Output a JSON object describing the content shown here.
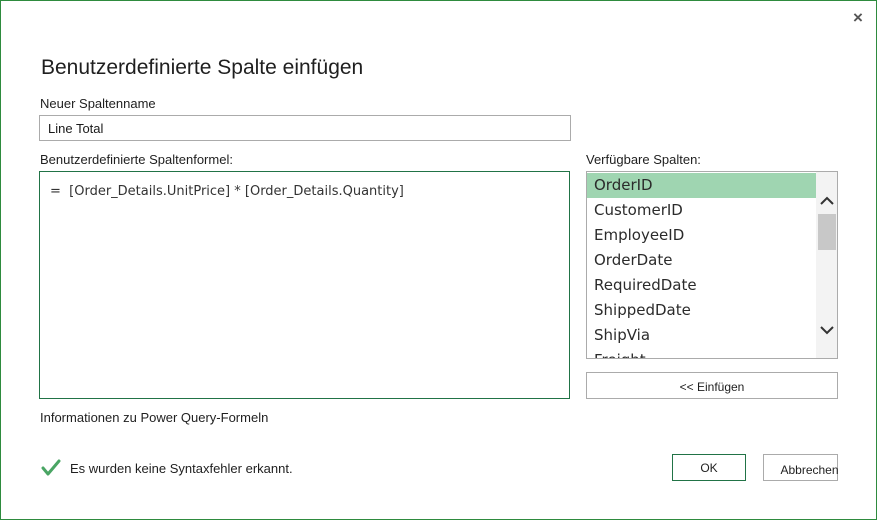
{
  "window": {
    "close_glyph": "×",
    "title": "Benutzerdefinierte Spalte einfügen"
  },
  "column_name": {
    "label": "Neuer Spaltenname",
    "value": "Line Total"
  },
  "formula": {
    "label": "Benutzerdefinierte Spaltenformel:",
    "value": "=  [Order_Details.UnitPrice] * [Order_Details.Quantity]"
  },
  "available_columns": {
    "label": "Verfügbare Spalten:",
    "items": [
      {
        "label": "OrderID",
        "selected": true
      },
      {
        "label": "CustomerID",
        "selected": false
      },
      {
        "label": "EmployeeID",
        "selected": false
      },
      {
        "label": "OrderDate",
        "selected": false
      },
      {
        "label": "RequiredDate",
        "selected": false
      },
      {
        "label": "ShippedDate",
        "selected": false
      },
      {
        "label": "ShipVia",
        "selected": false
      },
      {
        "label": "Freight",
        "selected": false
      }
    ],
    "insert_button": "<< Einfügen"
  },
  "info_link": "Informationen zu Power Query-Formeln",
  "status": {
    "icon": "checkmark-icon",
    "text": "Es wurden keine Syntaxfehler erkannt."
  },
  "buttons": {
    "ok": "OK",
    "cancel": "Abbrechen"
  },
  "colors": {
    "accent": "#217346",
    "selection": "#9fd5b1",
    "check": "#4aa564"
  }
}
